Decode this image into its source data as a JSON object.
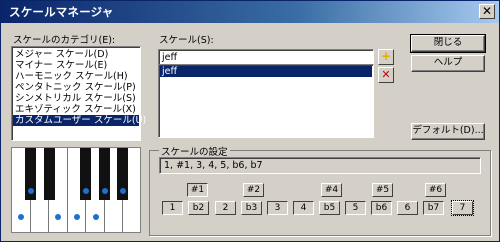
{
  "window": {
    "title": "スケールマネージャ",
    "close_glyph": "✕"
  },
  "categories": {
    "label": "スケールのカテゴリ(E):",
    "items": [
      {
        "label": "メジャー スケール(D)",
        "selected": false
      },
      {
        "label": "マイナー スケール(E)",
        "selected": false
      },
      {
        "label": "ハーモニック スケール(H)",
        "selected": false
      },
      {
        "label": "ペンタトニック スケール(P)",
        "selected": false
      },
      {
        "label": "シンメトリカル スケール(S)",
        "selected": false
      },
      {
        "label": "エキゾティック スケール(X)",
        "selected": false
      },
      {
        "label": "カスタムユーザー スケール(U)",
        "selected": true
      }
    ]
  },
  "scale": {
    "label": "スケール(S):",
    "name_value": "jeff",
    "list": [
      {
        "label": "jeff",
        "selected": true
      }
    ],
    "add_icon": "+",
    "delete_icon": "✕"
  },
  "buttons": {
    "close": "閉じる",
    "help": "ヘルプ",
    "default": "デフォルト(D)..."
  },
  "settings": {
    "label": "スケールの設定",
    "formula": "1, #1, 3, 4, 5, b6, b7",
    "upper": [
      {
        "label": "#1",
        "pressed": true
      },
      {
        "label": "#2",
        "pressed": false
      },
      {
        "label": "#4",
        "pressed": false
      },
      {
        "label": "#5",
        "pressed": false
      },
      {
        "label": "#6",
        "pressed": false
      }
    ],
    "lower": [
      {
        "label": "1",
        "pressed": true
      },
      {
        "label": "b2",
        "pressed": false
      },
      {
        "label": "2",
        "pressed": false
      },
      {
        "label": "b3",
        "pressed": false
      },
      {
        "label": "3",
        "pressed": true
      },
      {
        "label": "4",
        "pressed": true
      },
      {
        "label": "b5",
        "pressed": false
      },
      {
        "label": "5",
        "pressed": true
      },
      {
        "label": "b6",
        "pressed": true
      },
      {
        "label": "6",
        "pressed": false
      },
      {
        "label": "b7",
        "pressed": true
      },
      {
        "label": "7",
        "pressed": false
      }
    ]
  },
  "colors": {
    "title_start": "#0a246a",
    "selection": "#0a246a",
    "dot": "#1e6fd0",
    "add_icon": "#e0b000",
    "delete_icon": "#cc0000"
  }
}
